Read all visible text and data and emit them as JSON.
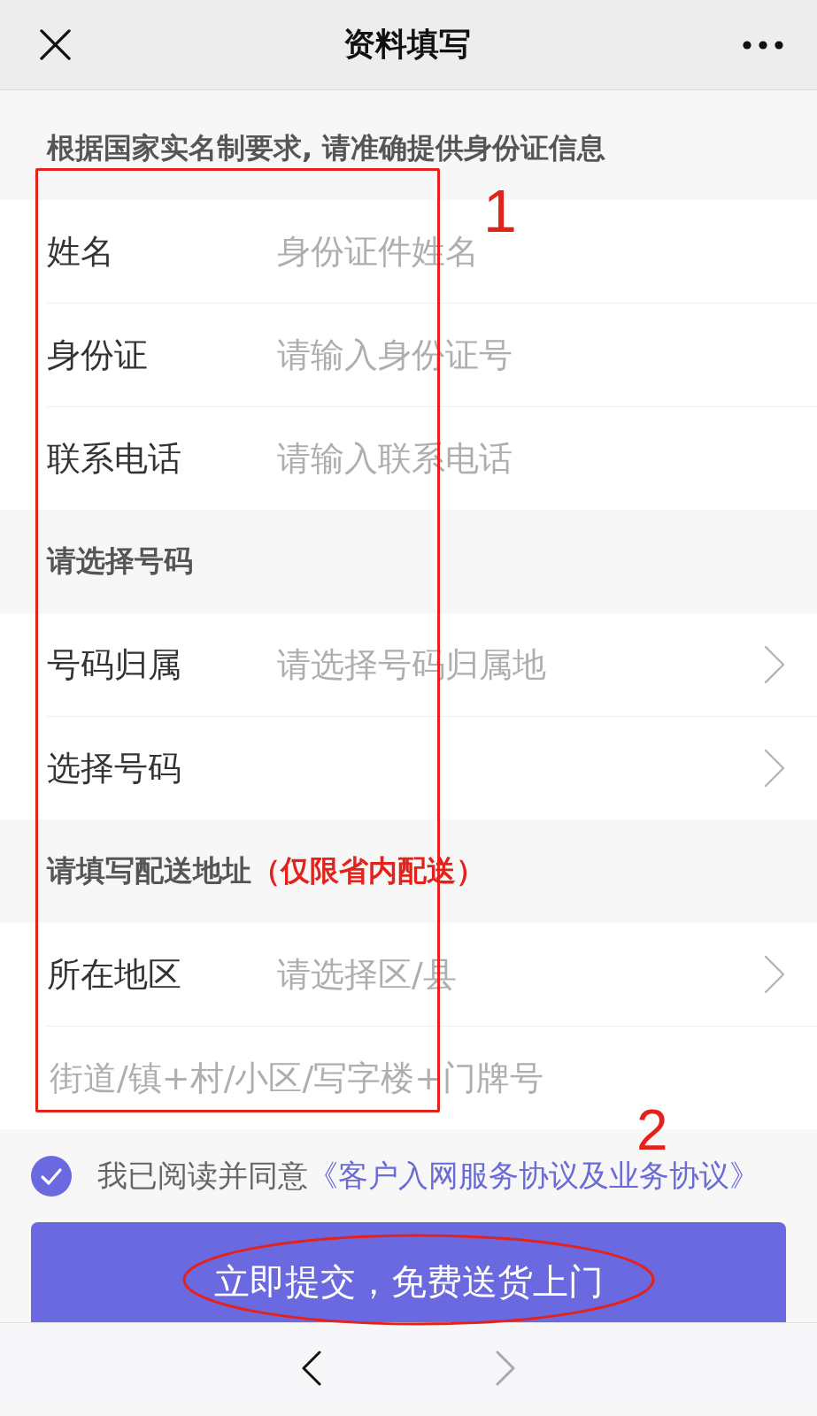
{
  "top_bar": {
    "title": "资料填写"
  },
  "notice": "根据国家实名制要求, 请准确提供身份证信息",
  "sections": [
    {
      "rows": [
        {
          "kind": "input",
          "label": "姓名",
          "placeholder": "身份证件姓名"
        },
        {
          "kind": "input",
          "label": "身份证",
          "placeholder": "请输入身份证号"
        },
        {
          "kind": "input",
          "label": "联系电话",
          "placeholder": "请输入联系电话"
        }
      ]
    },
    {
      "title": "请选择号码",
      "rows": [
        {
          "kind": "select",
          "label": "号码归属",
          "placeholder": "请选择号码归属地"
        },
        {
          "kind": "select",
          "label": "选择号码"
        }
      ]
    },
    {
      "title": "请填写配送地址",
      "note": "（仅限省内配送）",
      "rows": [
        {
          "kind": "select",
          "label": "所在地区",
          "placeholder": "请选择区/县"
        },
        {
          "kind": "textarea",
          "placeholder": "街道/镇+村/小区/写字楼+门牌号"
        }
      ]
    }
  ],
  "agreement": {
    "checked": true,
    "text": "我已阅读并同意",
    "link": "《客户入网服务协议及业务协议》"
  },
  "submit_button": "立即提交，免费送货上门",
  "bottom_bar": [
    {
      "kind": "back",
      "disabled": false
    },
    {
      "kind": "forward",
      "disabled": true
    }
  ],
  "annotations": [
    {
      "kind": "rectangle",
      "number": "1"
    },
    {
      "kind": "ellipse",
      "number": "2"
    }
  ]
}
